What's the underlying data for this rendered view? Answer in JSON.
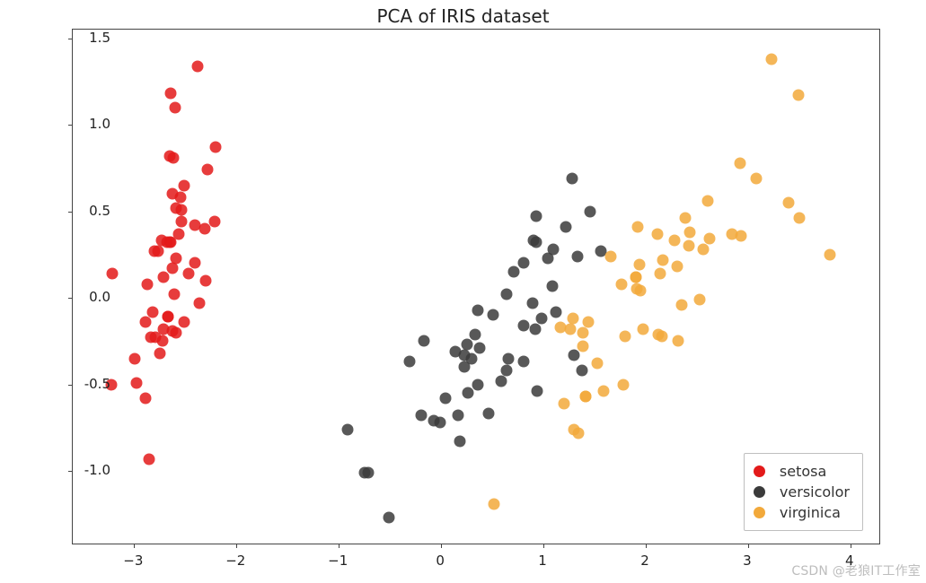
{
  "chart_data": {
    "type": "scatter",
    "title": "PCA of IRIS dataset",
    "xlabel": "",
    "ylabel": "",
    "xlim": [
      -3.6,
      4.3
    ],
    "ylim": [
      -1.43,
      1.55
    ],
    "xticks": [
      -3,
      -2,
      -1,
      0,
      1,
      2,
      3,
      4
    ],
    "yticks": [
      -1.0,
      -0.5,
      0.0,
      0.5,
      1.0,
      1.5
    ],
    "legend_position": "lower right",
    "series": [
      {
        "name": "setosa",
        "color": "#e31a1a",
        "points": [
          [
            -2.68,
            0.32
          ],
          [
            -2.71,
            -0.18
          ],
          [
            -2.89,
            -0.14
          ],
          [
            -2.75,
            -0.32
          ],
          [
            -2.73,
            0.33
          ],
          [
            -2.28,
            0.74
          ],
          [
            -2.82,
            -0.08
          ],
          [
            -2.63,
            0.17
          ],
          [
            -2.89,
            -0.58
          ],
          [
            -2.67,
            -0.11
          ],
          [
            -2.51,
            0.65
          ],
          [
            -2.61,
            0.02
          ],
          [
            -2.79,
            -0.23
          ],
          [
            -3.22,
            -0.5
          ],
          [
            -2.64,
            1.18
          ],
          [
            -2.38,
            1.34
          ],
          [
            -2.62,
            0.81
          ],
          [
            -2.65,
            0.32
          ],
          [
            -2.2,
            0.87
          ],
          [
            -2.59,
            0.52
          ],
          [
            -2.31,
            0.4
          ],
          [
            -2.54,
            0.44
          ],
          [
            -3.21,
            0.14
          ],
          [
            -2.3,
            0.1
          ],
          [
            -2.36,
            -0.03
          ],
          [
            -2.51,
            -0.14
          ],
          [
            -2.47,
            0.14
          ],
          [
            -2.56,
            0.37
          ],
          [
            -2.64,
            0.32
          ],
          [
            -2.63,
            -0.19
          ],
          [
            -2.59,
            -0.2
          ],
          [
            -2.41,
            0.42
          ],
          [
            -2.65,
            0.82
          ],
          [
            -2.6,
            1.1
          ],
          [
            -2.67,
            -0.11
          ],
          [
            -2.87,
            0.08
          ],
          [
            -2.63,
            0.6
          ],
          [
            -2.8,
            0.27
          ],
          [
            -2.98,
            -0.49
          ],
          [
            -2.59,
            0.23
          ],
          [
            -2.77,
            0.27
          ],
          [
            -2.85,
            -0.93
          ],
          [
            -2.99,
            -0.35
          ],
          [
            -2.41,
            0.2
          ],
          [
            -2.21,
            0.44
          ],
          [
            -2.72,
            -0.25
          ],
          [
            -2.54,
            0.51
          ],
          [
            -2.84,
            -0.23
          ],
          [
            -2.55,
            0.58
          ],
          [
            -2.71,
            0.12
          ]
        ]
      },
      {
        "name": "versicolor",
        "color": "#3b3b3b",
        "points": [
          [
            1.28,
            0.69
          ],
          [
            0.93,
            0.32
          ],
          [
            1.46,
            0.5
          ],
          [
            0.18,
            -0.83
          ],
          [
            1.09,
            0.07
          ],
          [
            0.64,
            -0.42
          ],
          [
            1.1,
            0.28
          ],
          [
            -0.75,
            -1.01
          ],
          [
            1.04,
            0.23
          ],
          [
            -0.01,
            -0.72
          ],
          [
            -0.51,
            -1.27
          ],
          [
            0.51,
            -0.1
          ],
          [
            0.26,
            -0.55
          ],
          [
            0.98,
            -0.12
          ],
          [
            -0.17,
            -0.25
          ],
          [
            0.93,
            0.47
          ],
          [
            0.66,
            -0.35
          ],
          [
            0.23,
            -0.33
          ],
          [
            0.94,
            -0.54
          ],
          [
            0.04,
            -0.58
          ],
          [
            1.12,
            -0.08
          ],
          [
            0.36,
            -0.07
          ],
          [
            1.3,
            -0.33
          ],
          [
            0.92,
            -0.18
          ],
          [
            0.71,
            0.15
          ],
          [
            0.9,
            0.33
          ],
          [
            1.33,
            0.24
          ],
          [
            1.56,
            0.27
          ],
          [
            0.81,
            -0.16
          ],
          [
            -0.31,
            -0.37
          ],
          [
            -0.07,
            -0.71
          ],
          [
            -0.19,
            -0.68
          ],
          [
            0.14,
            -0.31
          ],
          [
            1.38,
            -0.42
          ],
          [
            0.59,
            -0.48
          ],
          [
            0.81,
            0.2
          ],
          [
            1.22,
            0.41
          ],
          [
            0.81,
            -0.37
          ],
          [
            0.25,
            -0.27
          ],
          [
            0.17,
            -0.68
          ],
          [
            0.46,
            -0.67
          ],
          [
            0.89,
            -0.03
          ],
          [
            0.23,
            -0.4
          ],
          [
            -0.71,
            -1.01
          ],
          [
            0.36,
            -0.5
          ],
          [
            0.33,
            -0.21
          ],
          [
            0.38,
            -0.29
          ],
          [
            0.64,
            0.02
          ],
          [
            -0.91,
            -0.76
          ],
          [
            0.3,
            -0.35
          ]
        ]
      },
      {
        "name": "virginica",
        "color": "#f2a93b",
        "points": [
          [
            2.53,
            -0.01
          ],
          [
            1.41,
            -0.57
          ],
          [
            2.62,
            0.34
          ],
          [
            1.97,
            -0.18
          ],
          [
            2.35,
            -0.04
          ],
          [
            3.4,
            0.55
          ],
          [
            0.52,
            -1.19
          ],
          [
            2.93,
            0.36
          ],
          [
            2.32,
            -0.25
          ],
          [
            2.92,
            0.78
          ],
          [
            1.66,
            0.24
          ],
          [
            1.8,
            -0.22
          ],
          [
            2.17,
            0.22
          ],
          [
            1.34,
            -0.78
          ],
          [
            1.59,
            -0.54
          ],
          [
            1.9,
            0.12
          ],
          [
            1.95,
            0.04
          ],
          [
            3.49,
            1.17
          ],
          [
            3.8,
            0.25
          ],
          [
            1.3,
            -0.76
          ],
          [
            2.43,
            0.38
          ],
          [
            1.2,
            -0.61
          ],
          [
            3.5,
            0.46
          ],
          [
            1.39,
            -0.2
          ],
          [
            2.28,
            0.33
          ],
          [
            2.61,
            0.56
          ],
          [
            1.26,
            -0.18
          ],
          [
            1.29,
            -0.12
          ],
          [
            2.12,
            -0.21
          ],
          [
            2.39,
            0.46
          ],
          [
            2.84,
            0.37
          ],
          [
            3.23,
            1.38
          ],
          [
            2.16,
            -0.22
          ],
          [
            1.44,
            -0.14
          ],
          [
            1.78,
            -0.5
          ],
          [
            3.08,
            0.69
          ],
          [
            2.14,
            0.14
          ],
          [
            1.91,
            0.05
          ],
          [
            1.17,
            -0.17
          ],
          [
            2.11,
            0.37
          ],
          [
            2.31,
            0.18
          ],
          [
            1.92,
            0.41
          ],
          [
            1.41,
            -0.57
          ],
          [
            2.56,
            0.28
          ],
          [
            2.42,
            0.3
          ],
          [
            1.94,
            0.19
          ],
          [
            1.53,
            -0.38
          ],
          [
            1.76,
            0.08
          ],
          [
            1.9,
            0.12
          ],
          [
            1.39,
            -0.28
          ]
        ]
      }
    ]
  },
  "watermark": "CSDN @老狼IT工作室"
}
